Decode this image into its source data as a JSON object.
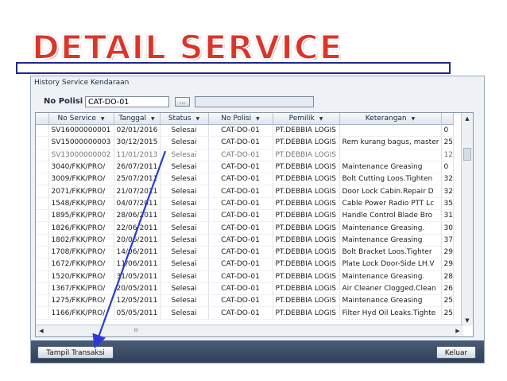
{
  "slide": {
    "title": "DETAIL SERVICE"
  },
  "window": {
    "title": "History Service Kendaraan",
    "polisi_label": "No Polisi :",
    "polisi_value": "CAT-DO-01",
    "browse_label": "...",
    "polisi_desc_value": ""
  },
  "grid": {
    "columns": [
      "No Service",
      "Tanggal",
      "Status",
      "No Polisi",
      "Pemilik",
      "Keterangan",
      ""
    ],
    "rows": [
      [
        "SV16000000001",
        "02/01/2016",
        "Selesai",
        "CAT-DO-01",
        "PT.DEBBIA LOGIS",
        "",
        "0"
      ],
      [
        "SV15000000003",
        "30/12/2015",
        "Selesai",
        "CAT-DO-01",
        "PT.DEBBIA LOGIS",
        "Rem kurang bagus, master",
        "25"
      ],
      [
        "SV13000000002",
        "11/01/2013",
        "Selesai",
        "CAT-DO-01",
        "PT.DEBBIA LOGIS",
        "",
        "12"
      ],
      [
        "3040/FKK/PRO/",
        "26/07/2011",
        "Selesai",
        "CAT-DO-01",
        "PT.DEBBIA LOGIS",
        "Maintenance Greasing",
        "0"
      ],
      [
        "3009/FKK/PRO/",
        "25/07/2011",
        "Selesai",
        "CAT-DO-01",
        "PT.DEBBIA LOGIS",
        "Bolt Cutting Loos.Tighten",
        "32"
      ],
      [
        "2071/FKK/PRO/",
        "21/07/2011",
        "Selesai",
        "CAT-DO-01",
        "PT.DEBBIA LOGIS",
        "Door Lock Cabin.Repair D",
        "32"
      ],
      [
        "1548/FKK/PRO/",
        "04/07/2011",
        "Selesai",
        "CAT-DO-01",
        "PT.DEBBIA LOGIS",
        "Cable Power Radio PTT Lc",
        "35"
      ],
      [
        "1895/FKK/PRO/",
        "28/06/2011",
        "Selesai",
        "CAT-DO-01",
        "PT.DEBBIA LOGIS",
        "Handle Control Blade Bro",
        "31"
      ],
      [
        "1826/FKK/PRO/",
        "22/06/2011",
        "Selesai",
        "CAT-DO-01",
        "PT.DEBBIA LOGIS",
        "Maintenance Greasing.",
        "30"
      ],
      [
        "1802/FKK/PRO/",
        "20/06/2011",
        "Selesai",
        "CAT-DO-01",
        "PT.DEBBIA LOGIS",
        "Maintenance Greasing",
        "37"
      ],
      [
        "1708/FKK/PRO/",
        "14/06/2011",
        "Selesai",
        "CAT-DO-01",
        "PT.DEBBIA LOGIS",
        "Bolt Bracket Loos.Tighter",
        "29"
      ],
      [
        "1672/FKK/PRO/",
        "11/06/2011",
        "Selesai",
        "CAT-DO-01",
        "PT.DEBBIA LOGIS",
        "Plate Lock Door-Side LH.V",
        "29"
      ],
      [
        "1520/FKK/PRO/",
        "31/05/2011",
        "Selesai",
        "CAT-DO-01",
        "PT.DEBBIA LOGIS",
        "Maintenance Greasing.",
        "28"
      ],
      [
        "1367/FKK/PRO/",
        "20/05/2011",
        "Selesai",
        "CAT-DO-01",
        "PT.DEBBIA LOGIS",
        "Air Cleaner Clogged.Clean",
        "26"
      ],
      [
        "1275/FKK/PRO/",
        "12/05/2011",
        "Selesai",
        "CAT-DO-01",
        "PT.DEBBIA LOGIS",
        "Maintenance Greasing",
        "25"
      ],
      [
        "1166/FKK/PRO/",
        "05/05/2011",
        "Selesai",
        "CAT-DO-01",
        "PT.DEBBIA LOGIS",
        "Filter Hyd Oil Leaks.Tighte",
        "25"
      ]
    ],
    "hscroll_thumb": "III"
  },
  "footer": {
    "tampil_label": "Tampil Transaksi",
    "keluar_label": "Keluar"
  },
  "colors": {
    "title": "#d9362b",
    "selection_outline": "#1f2a8c",
    "arrow": "#2b3bd1",
    "footer": "#3a4b66"
  },
  "icons": [
    "sort-arrow-icon",
    "scroll-up-icon",
    "scroll-down-icon",
    "scroll-left-icon",
    "scroll-right-icon"
  ]
}
